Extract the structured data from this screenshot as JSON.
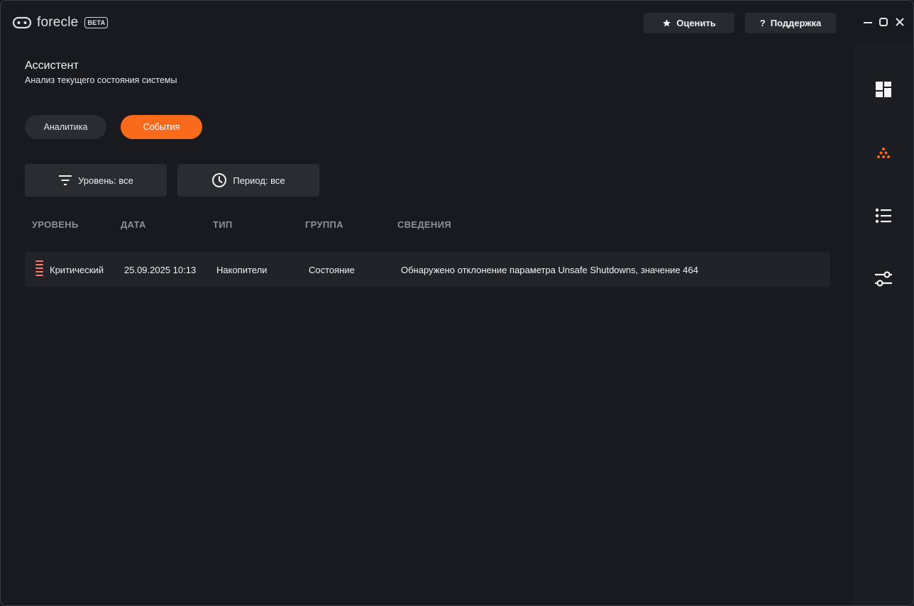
{
  "app": {
    "name": "forecle",
    "badge": "BETA"
  },
  "top_buttons": {
    "rate": "Оценить",
    "support": "Поддержка"
  },
  "header": {
    "title": "Ассистент",
    "subtitle": "Анализ текущего состояния системы"
  },
  "tabs": [
    {
      "label": "Аналитика",
      "active": false
    },
    {
      "label": "События",
      "active": true
    }
  ],
  "filters": {
    "level": "Уровень: все",
    "period": "Период: все"
  },
  "table": {
    "columns": [
      "УРОВЕНЬ",
      "ДАТА",
      "ТИП",
      "ГРУППА",
      "СВЕДЕНИЯ"
    ],
    "rows": [
      {
        "level": "Критический",
        "date": "25.09.2025 10:13",
        "type": "Накопители",
        "group": "Состояние",
        "details": "Обнаружено отклонение параметра Unsafe Shutdowns, значение 464"
      }
    ]
  },
  "sidebar": {
    "items": [
      {
        "icon": "dashboard-icon",
        "active": false
      },
      {
        "icon": "assistant-dots-icon",
        "active": true
      },
      {
        "icon": "list-icon",
        "active": false
      },
      {
        "icon": "sliders-icon",
        "active": false
      }
    ]
  },
  "colors": {
    "accent": "#fa6a1b",
    "critical": "#ff7a6b",
    "background": "#181a1f"
  }
}
